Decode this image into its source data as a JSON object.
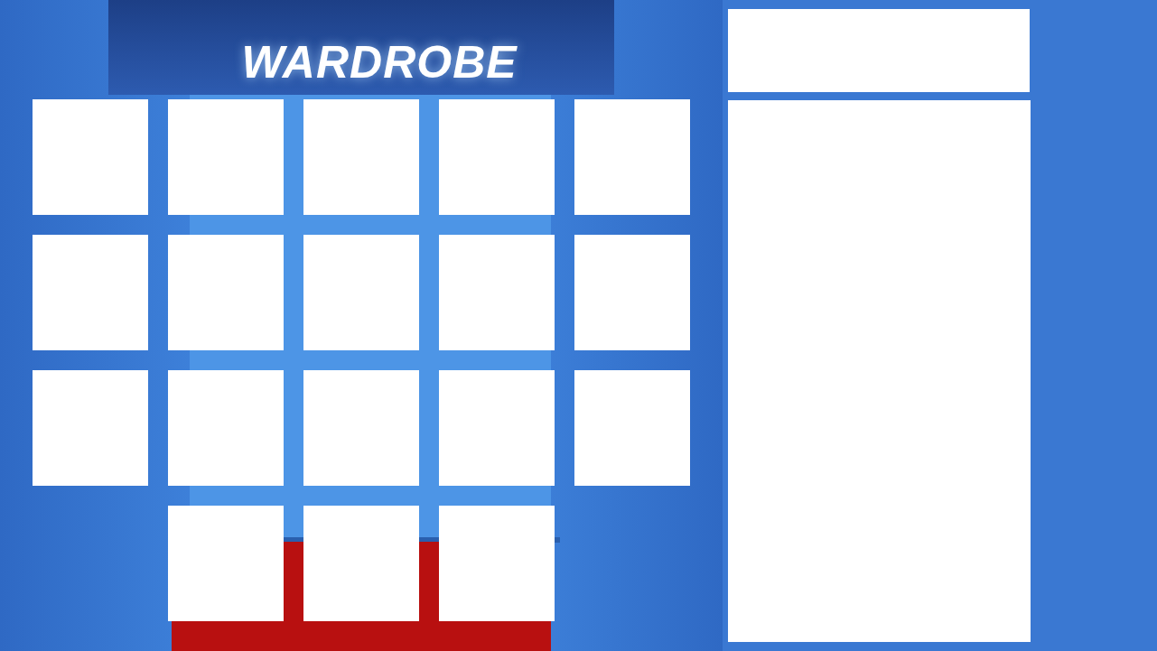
{
  "screen": {
    "title": "WARDROBE"
  },
  "slot_rows": [
    [
      {
        "filled": false
      },
      {
        "filled": false
      },
      {
        "filled": false
      },
      {
        "filled": false
      },
      {
        "filled": false
      }
    ],
    [
      {
        "filled": false
      },
      {
        "filled": false
      },
      {
        "filled": false
      },
      {
        "filled": false
      },
      {
        "filled": false
      }
    ],
    [
      {
        "filled": false
      },
      {
        "filled": false
      },
      {
        "filled": false
      },
      {
        "filled": false
      },
      {
        "filled": false
      }
    ],
    [
      {
        "filled": false
      },
      {
        "filled": false
      },
      {
        "filled": false
      }
    ]
  ],
  "info_panel": {
    "header": {
      "filled": false
    },
    "body": {
      "filled": false
    }
  }
}
